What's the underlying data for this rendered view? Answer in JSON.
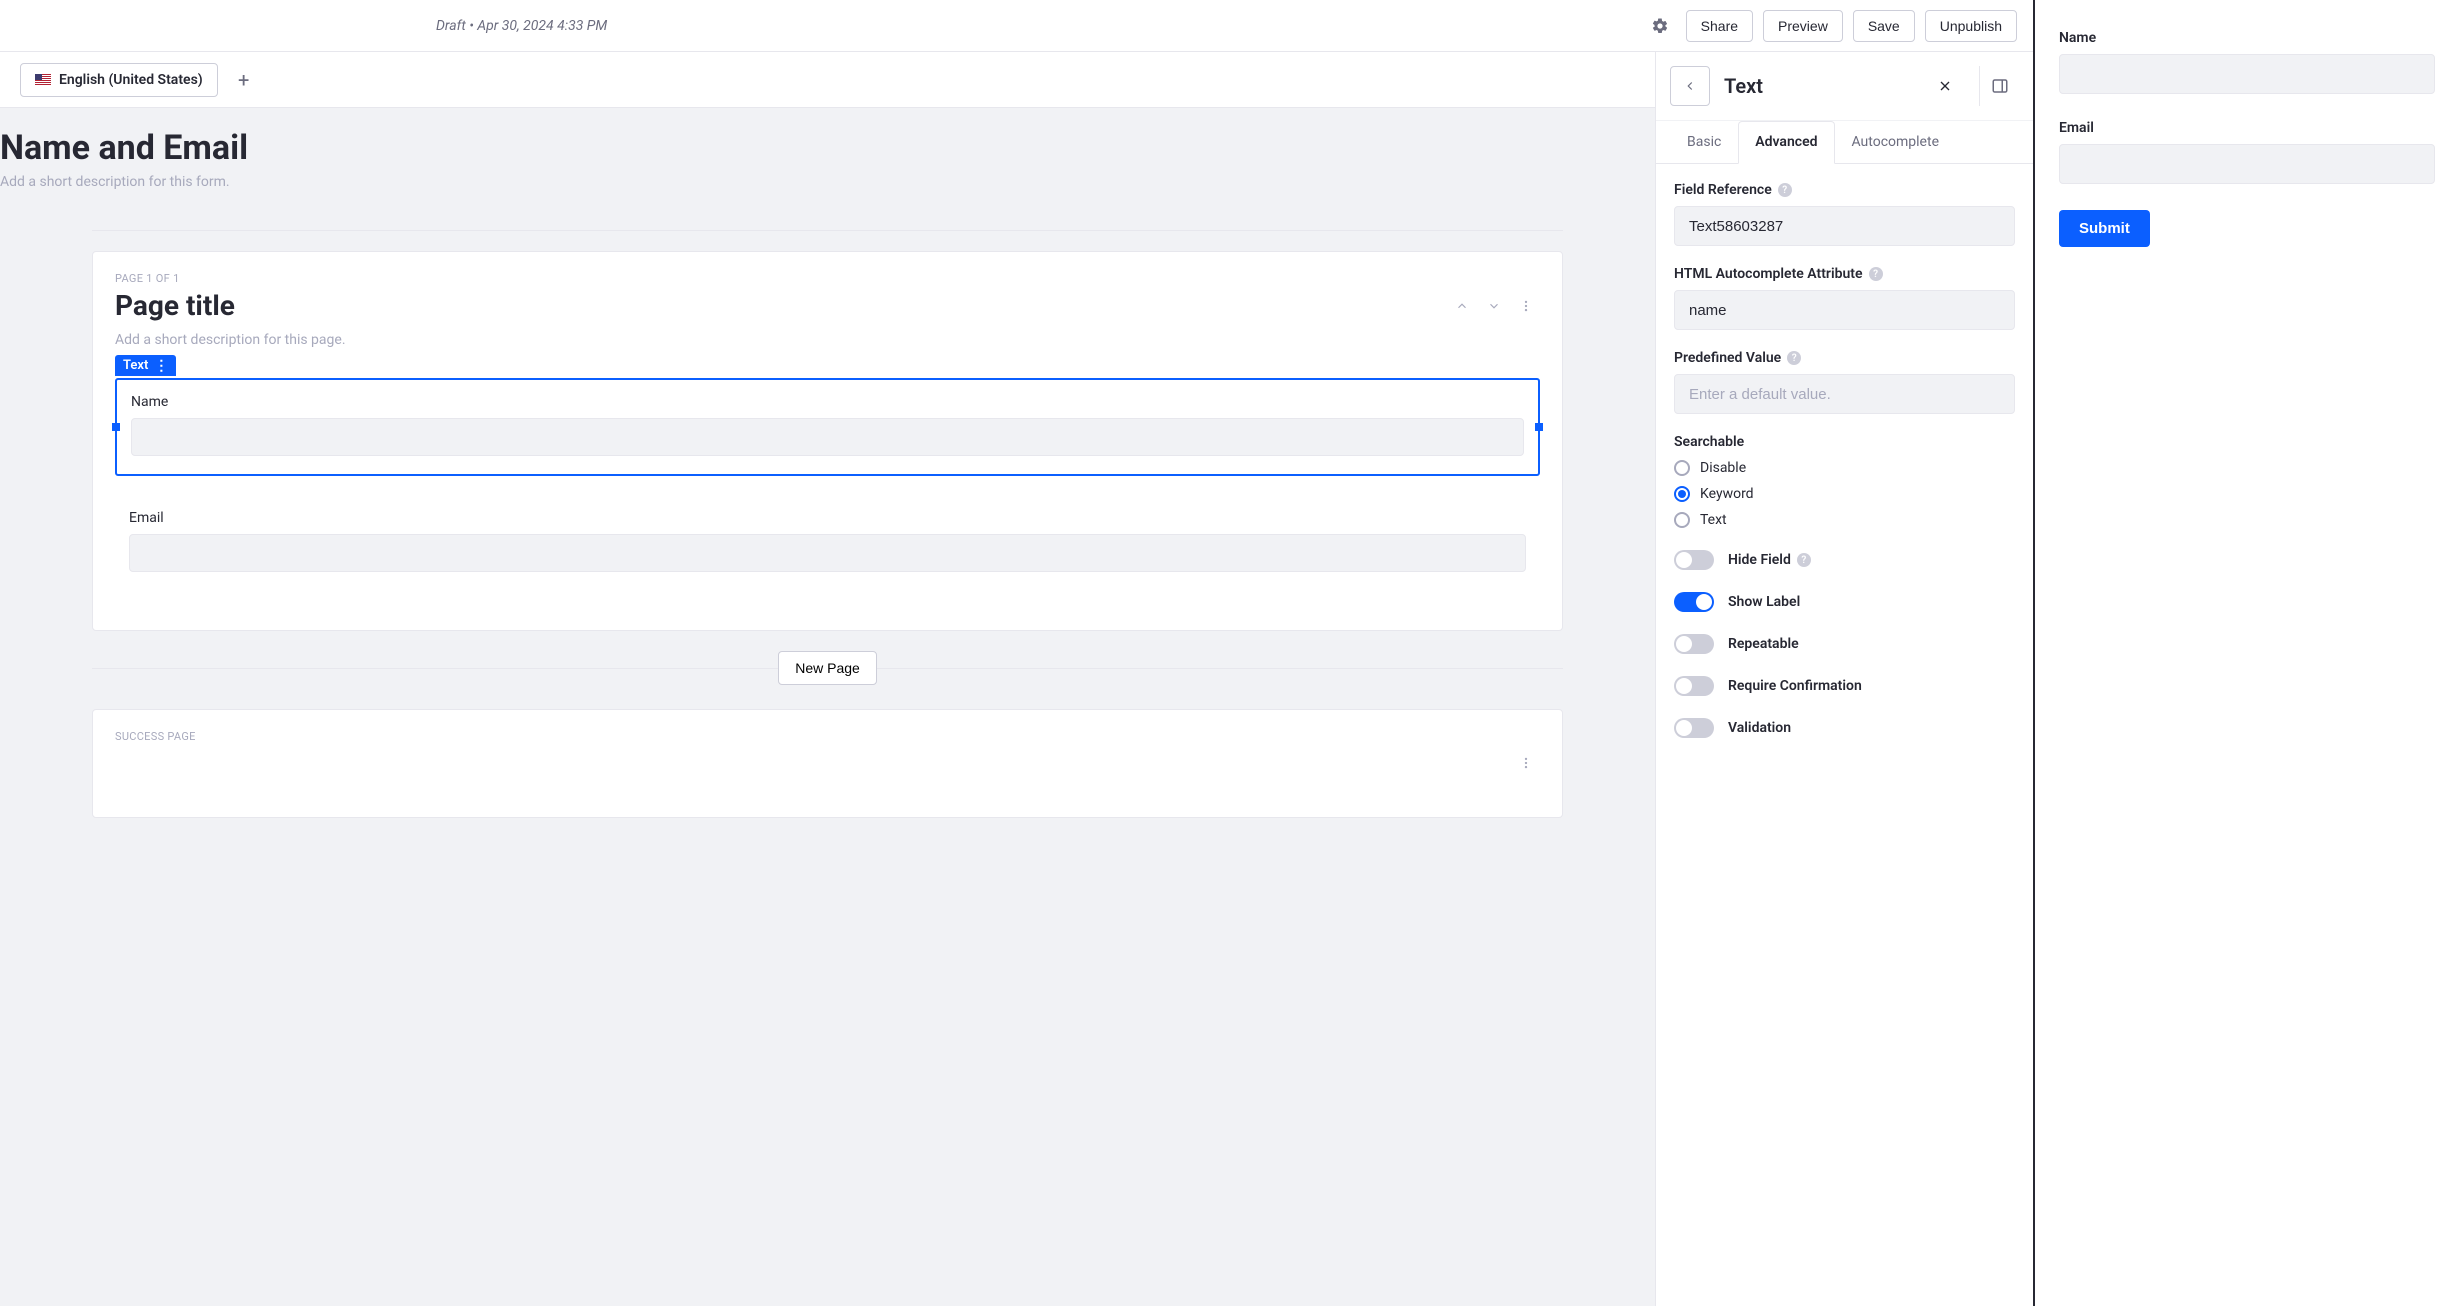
{
  "topbar": {
    "draft_label": "Draft • Apr 30, 2024 4:33 PM",
    "share": "Share",
    "preview": "Preview",
    "save": "Save",
    "unpublish": "Unpublish"
  },
  "language": {
    "current": "English (United States)"
  },
  "form": {
    "title": "Name and Email",
    "description_placeholder": "Add a short description for this form."
  },
  "page": {
    "meta": "PAGE 1 OF 1",
    "title": "Page title",
    "desc_placeholder": "Add a short description for this page.",
    "field_tag": "Text",
    "fields": {
      "name_label": "Name",
      "email_label": "Email"
    }
  },
  "new_page_label": "New Page",
  "success_page_meta": "SUCCESS PAGE",
  "props": {
    "title": "Text",
    "tabs": {
      "basic": "Basic",
      "advanced": "Advanced",
      "autocomplete": "Autocomplete"
    },
    "field_reference_label": "Field Reference",
    "field_reference_value": "Text58603287",
    "html_autocomplete_label": "HTML Autocomplete Attribute",
    "html_autocomplete_value": "name",
    "predefined_label": "Predefined Value",
    "predefined_placeholder": "Enter a default value.",
    "searchable_label": "Searchable",
    "searchable_options": {
      "disable": "Disable",
      "keyword": "Keyword",
      "text": "Text"
    },
    "toggles": {
      "hide_field": "Hide Field",
      "show_label": "Show Label",
      "repeatable": "Repeatable",
      "require_confirmation": "Require Confirmation",
      "validation": "Validation"
    }
  },
  "preview": {
    "name_label": "Name",
    "email_label": "Email",
    "submit": "Submit"
  }
}
